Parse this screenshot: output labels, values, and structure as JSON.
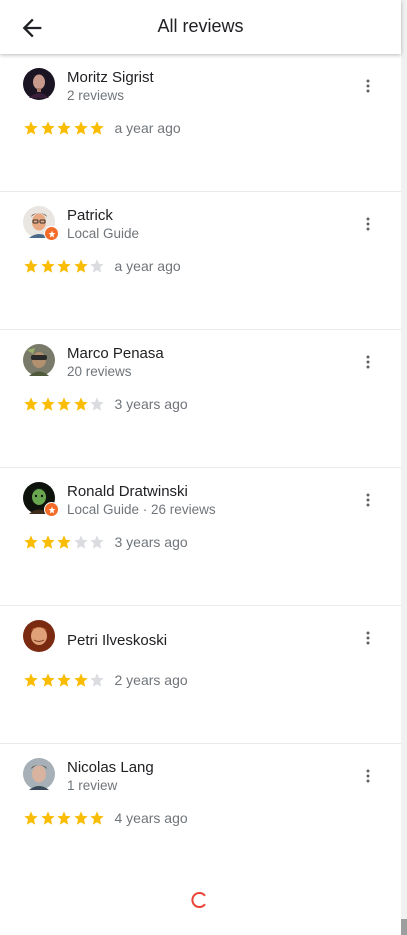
{
  "header": {
    "title": "All reviews",
    "back_icon": "arrow-left-icon"
  },
  "colors": {
    "star_filled": "#fbbc04",
    "star_empty": "#dadce0",
    "spinner": "#ea4335",
    "guide_badge": "#f26b28"
  },
  "reviews": [
    {
      "name": "Moritz Sigrist",
      "subtitle": "2 reviews",
      "rating": 5,
      "date": "a year ago",
      "local_guide": false
    },
    {
      "name": "Patrick",
      "subtitle": "Local Guide",
      "rating": 4,
      "date": "a year ago",
      "local_guide": true
    },
    {
      "name": "Marco Penasa",
      "subtitle": "20 reviews",
      "rating": 4,
      "date": "3 years ago",
      "local_guide": false
    },
    {
      "name": "Ronald Dratwinski",
      "subtitle": "Local Guide · 26 reviews",
      "rating": 3,
      "date": "3 years ago",
      "local_guide": true
    },
    {
      "name": "Petri Ilveskoski",
      "subtitle": "",
      "rating": 4,
      "date": "2 years ago",
      "local_guide": false
    },
    {
      "name": "Nicolas Lang",
      "subtitle": "1 review",
      "rating": 5,
      "date": "4 years ago",
      "local_guide": false
    }
  ]
}
